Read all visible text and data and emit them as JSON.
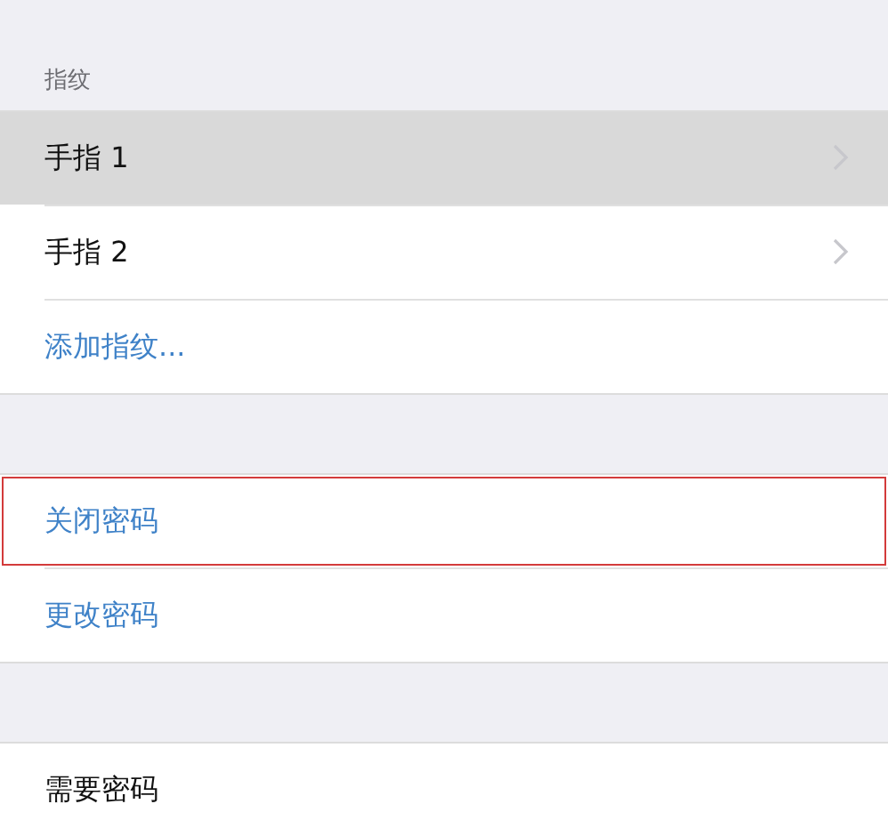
{
  "sections": [
    {
      "header": "指纹",
      "rows": [
        {
          "label": "手指 1",
          "kind": "nav",
          "selected": true,
          "outlined": false
        },
        {
          "label": "手指 2",
          "kind": "nav",
          "selected": false,
          "outlined": false
        },
        {
          "label": "添加指纹...",
          "kind": "action",
          "selected": false,
          "outlined": false
        }
      ]
    },
    {
      "rows": [
        {
          "label": "关闭密码",
          "kind": "action",
          "selected": false,
          "outlined": true
        },
        {
          "label": "更改密码",
          "kind": "action",
          "selected": false,
          "outlined": false
        }
      ]
    },
    {
      "rows": [
        {
          "label": "需要密码",
          "kind": "plain",
          "selected": false,
          "outlined": false
        }
      ]
    }
  ]
}
